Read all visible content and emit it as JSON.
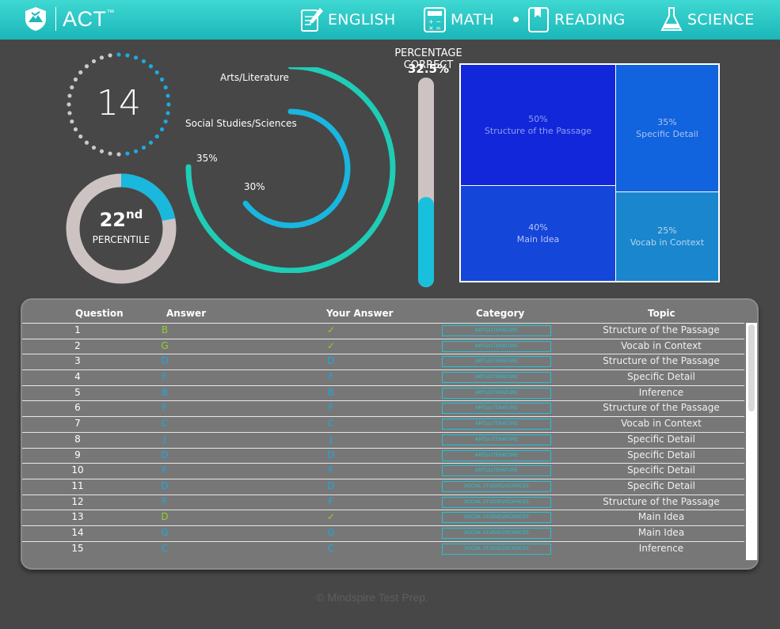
{
  "header": {
    "logo_text": "ACT",
    "logo_tm": "™",
    "nav": [
      {
        "label": "ENGLISH",
        "icon": "pencil-paper-icon"
      },
      {
        "label": "MATH",
        "icon": "calculator-icon"
      },
      {
        "label": "READING",
        "icon": "book-icon",
        "active": true
      },
      {
        "label": "SCIENCE",
        "icon": "flask-icon"
      }
    ]
  },
  "score": {
    "value": "14"
  },
  "percentile": {
    "number": "22",
    "suffix": "nd",
    "label": "PERCENTILE",
    "fraction": 0.22
  },
  "arcs": [
    {
      "label": "Arts/Literature",
      "percent_label": "35%",
      "value": 35
    },
    {
      "label": "Social Studies/Sciences",
      "percent_label": "30%",
      "value": 30
    }
  ],
  "percentage_correct": {
    "title": "PERCENTAGE CORRECT",
    "value_label": "32.5%",
    "value": 32.5
  },
  "treemap": [
    {
      "percent": "50%",
      "label": "Structure of the Passage"
    },
    {
      "percent": "35%",
      "label": "Specific Detail"
    },
    {
      "percent": "40%",
      "label": "Main Idea"
    },
    {
      "percent": "25%",
      "label": "Vocab in Context"
    }
  ],
  "table": {
    "headers": [
      "Question",
      "Answer",
      "Your Answer",
      "Category",
      "Topic"
    ],
    "rows": [
      {
        "q": "1",
        "a": "B",
        "ya": "✓",
        "cat": "ARTS/LITERATURE",
        "topic": "Structure of the Passage",
        "correct": true
      },
      {
        "q": "2",
        "a": "G",
        "ya": "✓",
        "cat": "ARTS/LITERATURE",
        "topic": "Vocab in Context",
        "correct": true
      },
      {
        "q": "3",
        "a": "D",
        "ya": "D",
        "cat": "ARTS/LITERATURE",
        "topic": "Structure of the Passage",
        "correct": false
      },
      {
        "q": "4",
        "a": "F",
        "ya": "F",
        "cat": "ARTS/LITERATURE",
        "topic": "Specific Detail",
        "correct": false
      },
      {
        "q": "5",
        "a": "B",
        "ya": "B",
        "cat": "ARTS/LITERATURE",
        "topic": "Inference",
        "correct": false
      },
      {
        "q": "6",
        "a": "F",
        "ya": "F",
        "cat": "ARTS/LITERATURE",
        "topic": "Structure of the Passage",
        "correct": false
      },
      {
        "q": "7",
        "a": "C",
        "ya": "C",
        "cat": "ARTS/LITERATURE",
        "topic": "Vocab in Context",
        "correct": false
      },
      {
        "q": "8",
        "a": "J",
        "ya": "J",
        "cat": "ARTS/LITERATURE",
        "topic": "Specific Detail",
        "correct": false
      },
      {
        "q": "9",
        "a": "D",
        "ya": "D",
        "cat": "ARTS/LITERATURE",
        "topic": "Specific Detail",
        "correct": false
      },
      {
        "q": "10",
        "a": "F",
        "ya": "F",
        "cat": "ARTS/LITERATURE",
        "topic": "Specific Detail",
        "correct": false
      },
      {
        "q": "11",
        "a": "D",
        "ya": "D",
        "cat": "SOCIAL STUDIES/SCIENCES",
        "topic": "Specific Detail",
        "correct": false
      },
      {
        "q": "12",
        "a": "F",
        "ya": "F",
        "cat": "SOCIAL STUDIES/SCIENCES",
        "topic": "Structure of the Passage",
        "correct": false
      },
      {
        "q": "13",
        "a": "D",
        "ya": "✓",
        "cat": "SOCIAL STUDIES/SCIENCES",
        "topic": "Main Idea",
        "correct": true
      },
      {
        "q": "14",
        "a": "G",
        "ya": "G",
        "cat": "SOCIAL STUDIES/SCIENCES",
        "topic": "Main Idea",
        "correct": false
      },
      {
        "q": "15",
        "a": "C",
        "ya": "C",
        "cat": "SOCIAL STUDIES/SCIENCES",
        "topic": "Inference",
        "correct": false
      }
    ]
  },
  "footer": {
    "text": "© Mindspire Test Prep."
  },
  "colors": {
    "correct": "#8fd12a",
    "wrong": "#1ea7e0",
    "accent": "#1bb7b9",
    "teal_arc": "#1fcdb6",
    "blue_arc": "#19b6df"
  }
}
